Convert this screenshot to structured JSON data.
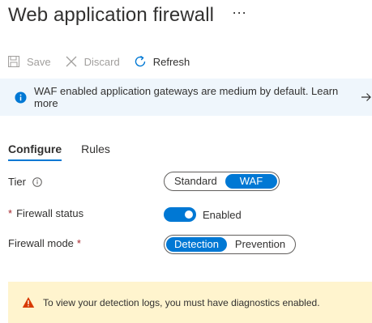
{
  "header": {
    "title": "Web application firewall",
    "more_label": "···"
  },
  "toolbar": {
    "save_label": "Save",
    "discard_label": "Discard",
    "refresh_label": "Refresh"
  },
  "info_banner": {
    "text": "WAF enabled application gateways are medium by default. Learn more"
  },
  "tabs": [
    {
      "label": "Configure",
      "active": true
    },
    {
      "label": "Rules",
      "active": false
    }
  ],
  "form": {
    "tier": {
      "label": "Tier",
      "options": [
        "Standard",
        "WAF"
      ],
      "selected": "WAF"
    },
    "firewall_status": {
      "label": "Firewall status",
      "required": "*",
      "value_label": "Enabled",
      "on": true
    },
    "firewall_mode": {
      "label": "Firewall mode",
      "required": "*",
      "options": [
        "Detection",
        "Prevention"
      ],
      "selected": "Detection"
    }
  },
  "warning_banner": {
    "text": "To view your detection logs, you must have diagnostics enabled."
  },
  "colors": {
    "accent": "#0078d4",
    "info_bg": "#eff6fc",
    "warning_bg": "#fff4ce",
    "warning_icon": "#d83b01",
    "required": "#a4262c"
  }
}
